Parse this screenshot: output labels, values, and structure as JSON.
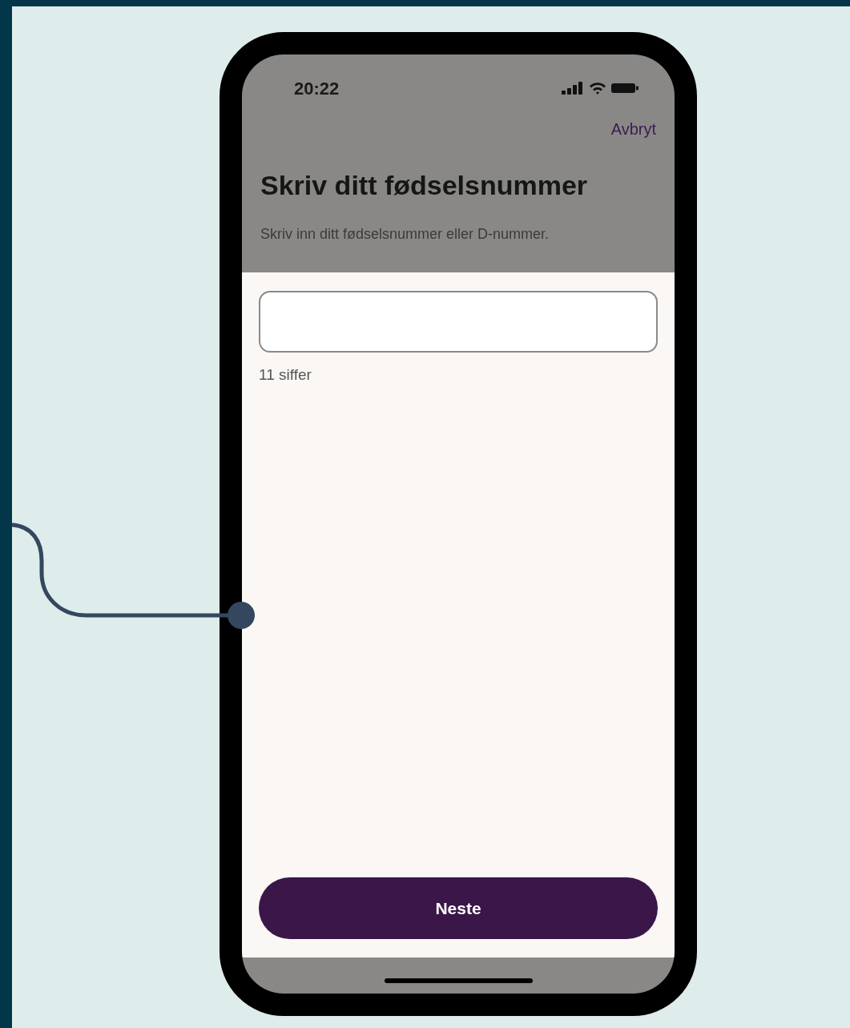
{
  "status_bar": {
    "time": "20:22"
  },
  "header": {
    "cancel": "Avbryt",
    "title": "Skriv ditt fødselsnummer",
    "subtitle": "Skriv inn ditt fødselsnummer eller D-nummer."
  },
  "input": {
    "helper": "11 siffer"
  },
  "button": {
    "label": "Neste"
  }
}
